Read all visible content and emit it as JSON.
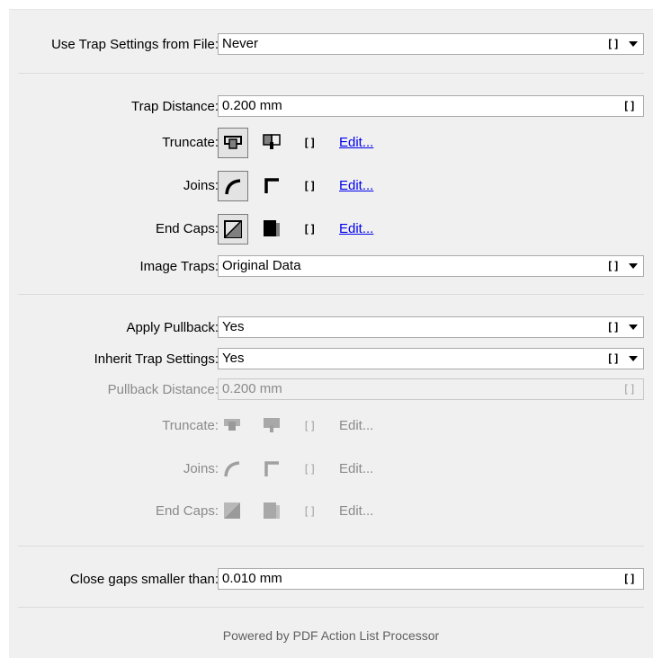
{
  "use_trap_settings": {
    "label": "Use Trap Settings from File:",
    "value": "Never"
  },
  "trap_distance": {
    "label": "Trap Distance:",
    "value": "0.200 mm"
  },
  "trap_truncate": {
    "label": "Truncate:",
    "edit": "Edit..."
  },
  "trap_joins": {
    "label": "Joins:",
    "edit": "Edit..."
  },
  "trap_end_caps": {
    "label": "End Caps:",
    "edit": "Edit..."
  },
  "image_traps": {
    "label": "Image Traps:",
    "value": "Original Data"
  },
  "apply_pullback": {
    "label": "Apply Pullback:",
    "value": "Yes"
  },
  "inherit_trap": {
    "label": "Inherit Trap Settings:",
    "value": "Yes"
  },
  "pullback_distance": {
    "label": "Pullback Distance:",
    "value": "0.200 mm"
  },
  "pb_truncate": {
    "label": "Truncate:",
    "edit": "Edit..."
  },
  "pb_joins": {
    "label": "Joins:",
    "edit": "Edit..."
  },
  "pb_end_caps": {
    "label": "End Caps:",
    "edit": "Edit..."
  },
  "close_gaps": {
    "label": "Close gaps smaller than:",
    "value": "0.010 mm"
  },
  "footer": {
    "text": "Powered by PDF Action List Processor"
  },
  "glyphs": {
    "bracket": "[]"
  },
  "colors": {
    "link": "#0000ee",
    "disabled_text": "#8a8a8a",
    "panel_bg": "#f0f0f0"
  }
}
